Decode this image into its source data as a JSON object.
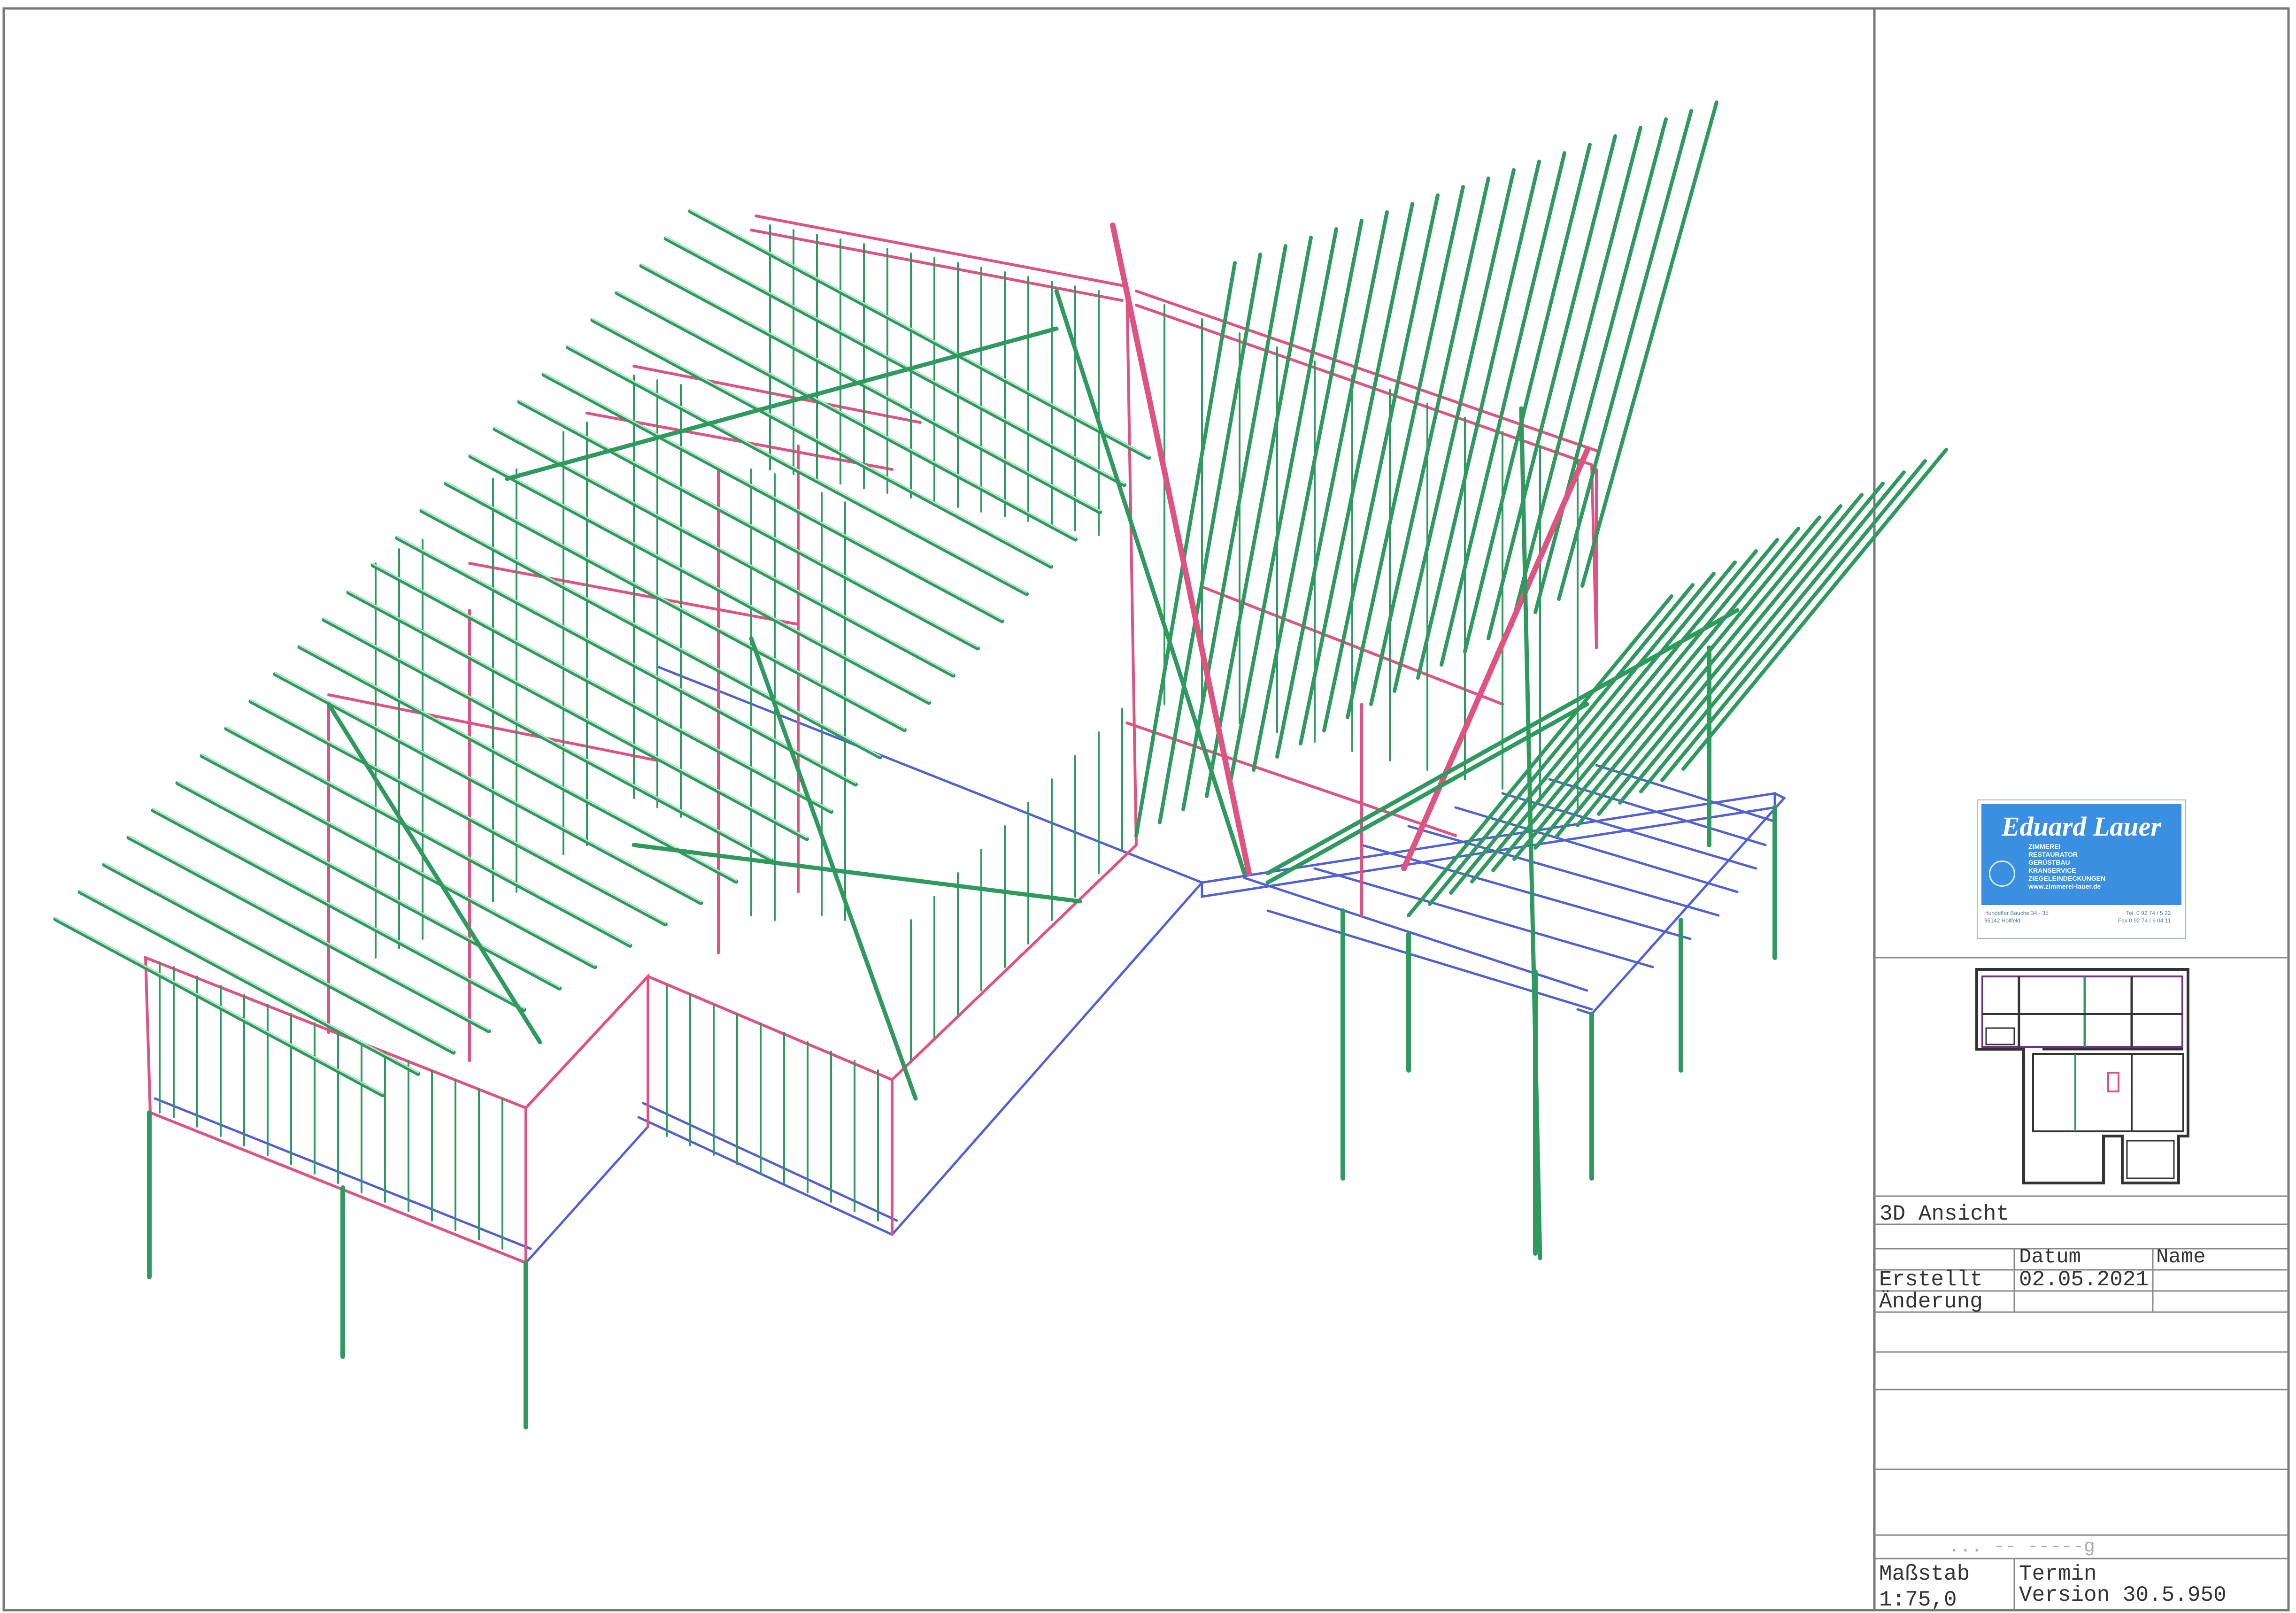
{
  "drawing": {
    "title": "3D Ansicht",
    "table": {
      "col_datum": "Datum",
      "col_name": "Name",
      "row_erstellt": "Erstellt",
      "row_erstellt_datum": "02.05.2021",
      "row_aenderung": "Änderung",
      "scale_label": "Maßstab",
      "scale_value": "1:75,0",
      "termin_label": "Termin",
      "version": "Version 30.5.950",
      "smudged_text": "... -- -----g"
    }
  },
  "company_logo": {
    "name": "Eduard Lauer",
    "services": [
      "ZIMMEREI",
      "RESTAURATOR",
      "GERÜSTBAU",
      "KRANSERVICE",
      "ZIEGELEINDECKUNGEN",
      "www.zimmerei-lauer.de"
    ],
    "address_line_1": "Hundelfer Bäuche 34 - 35",
    "address_line_2": "96142 Hollfeld",
    "phone": "Tel. 0 92 74 / 5 22",
    "fax": "Fax 0 92 74 / 6 04 11"
  },
  "colors": {
    "frame": "#666666",
    "studs_green": "#2e9a5e",
    "plates_pink": "#e0527f",
    "beams_blue": "#5060d8",
    "logo_blue": "#3a8fe0"
  },
  "icons": [
    "floorplan-thumbnail-icon",
    "company-logo-icon",
    "framing-3d-view-icon"
  ]
}
